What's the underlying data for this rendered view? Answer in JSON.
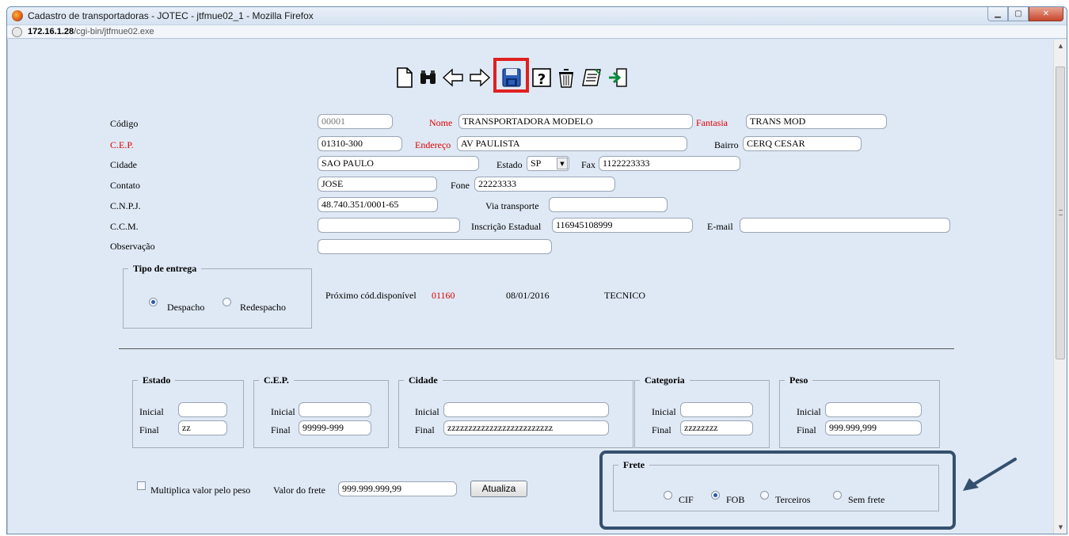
{
  "window": {
    "title": "Cadastro de transportadoras - JOTEC - jtfmue02_1 - Mozilla Firefox"
  },
  "address": {
    "host": "172.16.1.28",
    "path": "/cgi-bin/jtfmue02.exe"
  },
  "toolbar": {
    "icons": [
      "new-document-icon",
      "binoculars-search-icon",
      "arrow-left-icon",
      "arrow-right-icon",
      "save-disk-icon",
      "help-icon",
      "trash-icon",
      "notepad-icon",
      "exit-door-icon"
    ],
    "highlighted": "save-disk-icon"
  },
  "form": {
    "codigo": {
      "label": "Código",
      "value": "00001"
    },
    "nome": {
      "label": "Nome",
      "value": "TRANSPORTADORA MODELO"
    },
    "fantasia": {
      "label": "Fantasia",
      "value": "TRANS MOD"
    },
    "cep": {
      "label": "C.E.P.",
      "value": "01310-300"
    },
    "endereco": {
      "label": "Endereço",
      "value": "AV PAULISTA"
    },
    "bairro": {
      "label": "Bairro",
      "value": "CERQ CESAR"
    },
    "cidade": {
      "label": "Cidade",
      "value": "SAO PAULO"
    },
    "estado": {
      "label": "Estado",
      "value": "SP"
    },
    "fax": {
      "label": "Fax",
      "value": "1122223333"
    },
    "contato": {
      "label": "Contato",
      "value": "JOSE"
    },
    "fone": {
      "label": "Fone",
      "value": "22223333"
    },
    "cnpj": {
      "label": "C.N.P.J.",
      "value": "48.740.351/0001-65"
    },
    "via_transporte": {
      "label": "Via transporte",
      "value": ""
    },
    "ccm": {
      "label": "C.C.M.",
      "value": ""
    },
    "inscricao": {
      "label": "Inscrição Estadual",
      "value": "116945108999"
    },
    "email": {
      "label": "E-mail",
      "value": ""
    },
    "observacao": {
      "label": "Observação",
      "value": ""
    }
  },
  "tipo_entrega": {
    "legend": "Tipo de entrega",
    "options": [
      "Despacho",
      "Redespacho"
    ],
    "selected": "Despacho"
  },
  "info": {
    "proximo_label": "Próximo cód.disponível",
    "proximo_value": "01160",
    "date": "08/01/2016",
    "user": "TECNICO"
  },
  "ranges": {
    "estado": {
      "legend": "Estado",
      "inicial": "",
      "final": "zz"
    },
    "cep": {
      "legend": "C.E.P.",
      "inicial": "",
      "final": "99999-999"
    },
    "cidade": {
      "legend": "Cidade",
      "inicial": "",
      "final": "zzzzzzzzzzzzzzzzzzzzzzzzz"
    },
    "categoria": {
      "legend": "Categoria",
      "inicial": "",
      "final": "zzzzzzzz"
    },
    "peso": {
      "legend": "Peso",
      "inicial": "",
      "final": "999.999,999"
    },
    "inicial_label": "Inicial",
    "final_label": "Final"
  },
  "frete_calc": {
    "multiplica_label": "Multiplica valor pelo peso",
    "multiplica_checked": false,
    "valor_label": "Valor do frete",
    "valor_value": "999.999.999,99",
    "atualiza_label": "Atualiza"
  },
  "frete": {
    "legend": "Frete",
    "options": [
      "CIF",
      "FOB",
      "Terceiros",
      "Sem frete"
    ],
    "selected": "FOB"
  },
  "colors": {
    "highlight_box": "#34506f",
    "arrow": "#34506f",
    "save_highlight": "#e02020",
    "required_label": "#e00000"
  }
}
